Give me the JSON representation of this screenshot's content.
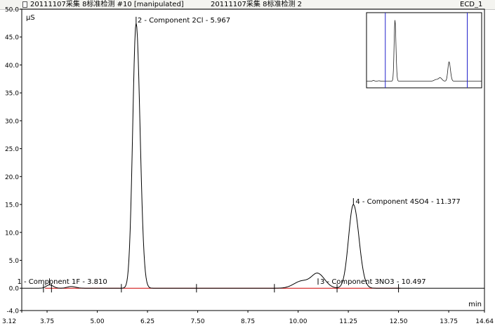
{
  "window": {
    "title_left": "20111107采集 8标准检测 #10 [manipulated]",
    "title_mid": "20111107采集 8标准检测 2",
    "title_right": "ECD_1"
  },
  "colors": {
    "trace": "#000000",
    "baseline": "#cc0000",
    "inset_marker": "#2222cc",
    "border": "#000000"
  },
  "chart_data": {
    "type": "line",
    "title": "",
    "xlabel": "min",
    "ylabel": "µS",
    "xlim": [
      3.12,
      14.64
    ],
    "ylim": [
      -4.0,
      50.0
    ],
    "x_ticks": [
      3.12,
      3.75,
      5.0,
      6.25,
      7.5,
      8.75,
      10.0,
      11.25,
      12.5,
      13.75,
      14.64
    ],
    "x_tick_labels": [
      "3.12",
      "3.75",
      "5.00",
      "6.25",
      "7.50",
      "8.75",
      "10.00",
      "11.25",
      "12.50",
      "13.75",
      "14.64"
    ],
    "y_ticks": [
      -4.0,
      0.0,
      5.0,
      10.0,
      15.0,
      20.0,
      25.0,
      30.0,
      35.0,
      40.0,
      45.0,
      50.0
    ],
    "y_tick_labels": [
      "-4.0",
      "0.0",
      "5.0",
      "10.0",
      "15.0",
      "20.0",
      "25.0",
      "30.0",
      "35.0",
      "40.0",
      "45.0",
      "50.0"
    ],
    "baseline": 0.0,
    "peaks": [
      {
        "x": 3.81,
        "height": 0.6,
        "width": 0.08,
        "label": "1 - Component 1F - 3.810"
      },
      {
        "x": 4.35,
        "height": 0.3,
        "width": 0.1,
        "label": ""
      },
      {
        "x": 5.967,
        "height": 47.5,
        "width": 0.085,
        "label": "2 - Component 2Cl - 5.967"
      },
      {
        "x": 10.1,
        "height": 1.3,
        "width": 0.2,
        "label": ""
      },
      {
        "x": 10.497,
        "height": 2.4,
        "width": 0.15,
        "label": "3 - Component 3NO3 - 10.497"
      },
      {
        "x": 11.377,
        "height": 15.0,
        "width": 0.12,
        "label": "4 - Component 4SO4 - 11.377"
      }
    ],
    "inset": {
      "description_none": "",
      "markers": [
        5.0,
        13.2
      ]
    }
  }
}
